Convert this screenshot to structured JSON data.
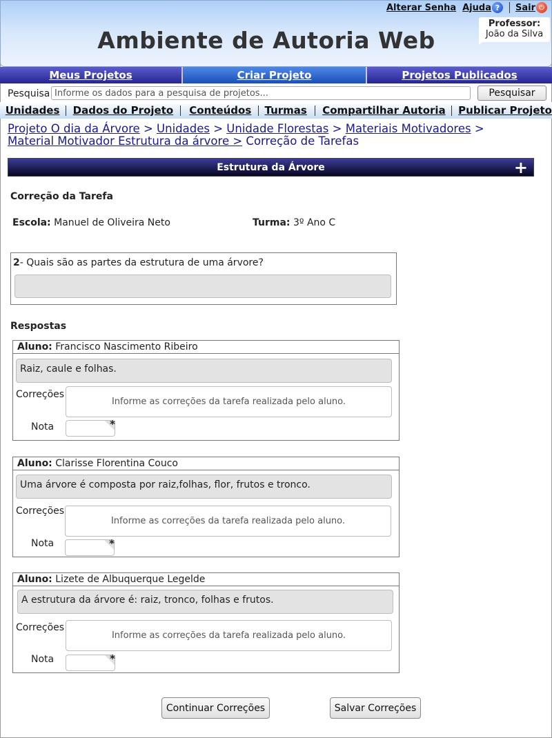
{
  "header": {
    "title": "Ambiente de Autoria Web",
    "links": {
      "alterar_senha": "Alterar Senha",
      "ajuda": "Ajuda",
      "sair": "Sair"
    },
    "professor_label": "Professor:",
    "professor_name": "João da Silva"
  },
  "main_nav": [
    {
      "label": "Meus Projetos",
      "active": false
    },
    {
      "label": "Criar Projeto",
      "active": true
    },
    {
      "label": "Projetos Publicados",
      "active": false
    }
  ],
  "search": {
    "label": "Pesquisa",
    "placeholder": "Informe os dados para a pesquisa de projetos...",
    "button": "Pesquisar"
  },
  "sub_nav": [
    "Unidades",
    "Dados do Projeto",
    "Conteúdos",
    "Turmas",
    "Compartilhar Autoria",
    "Publicar Projeto"
  ],
  "breadcrumb": {
    "links": [
      "Projeto O dia da Árvore",
      "Unidades",
      "Unidade Florestas",
      "Materiais Motivadores",
      "Material Motivador Estrutura da árvore"
    ],
    "current": "Correção de Tarefas"
  },
  "section": {
    "title": "Estrutura da Árvore",
    "expand_icon": "plus-icon"
  },
  "heading": "Correção da Tarefa",
  "escola": {
    "label": "Escola:",
    "value": "Manuel de Oliveira Neto"
  },
  "turma": {
    "label": "Turma:",
    "value": "3º Ano C"
  },
  "question": {
    "number": "2",
    "text": "Quais são as partes  da estrutura de uma árvore?"
  },
  "respostas_label": "Respostas",
  "answers": [
    {
      "aluno_label": "Aluno:",
      "aluno": "Francisco Nascimento Ribeiro",
      "answer": "Raiz, caule e folhas.",
      "correcoes_label": "Correções",
      "correcoes_placeholder": "Informe as correções da tarefa realizada pelo aluno.",
      "nota_label": "Nota",
      "nota_required": "*"
    },
    {
      "aluno_label": "Aluno:",
      "aluno": "Clarisse  Florentina Couco",
      "answer": "Uma árvore é composta por raiz,folhas, flor, frutos e tronco.",
      "correcoes_label": "Correções",
      "correcoes_placeholder": "Informe as correções da tarefa realizada pelo aluno.",
      "nota_label": "Nota",
      "nota_required": "*"
    },
    {
      "aluno_label": "Aluno:",
      "aluno": "Lizete de Albuquerque Legelde",
      "answer": "A estrutura da árvore é: raiz, tronco, folhas e frutos.",
      "correcoes_label": "Correções",
      "correcoes_placeholder": "Informe as correções da tarefa realizada pelo aluno.",
      "nota_label": "Nota",
      "nota_required": "*"
    }
  ],
  "buttons": {
    "continuar": "Continuar Correções",
    "salvar": "Salvar Correções"
  }
}
